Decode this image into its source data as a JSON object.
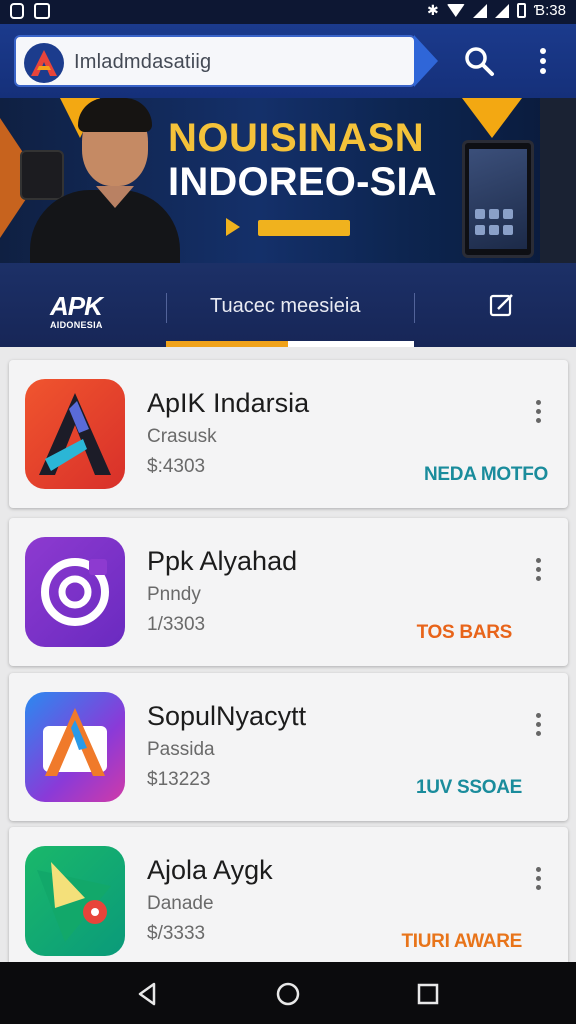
{
  "status_bar": {
    "time": "Ɓ:38",
    "left_icons": [
      "lock-icon",
      "image-icon"
    ],
    "right_icons": [
      "bluetooth-icon",
      "wifi-icon",
      "signal-icon",
      "battery-icon"
    ]
  },
  "app_bar": {
    "search_text": "Imladmdasatiig",
    "search_icon": "search-icon",
    "more_icon": "more-vertical-icon",
    "accent": "#1b3a8c"
  },
  "banner": {
    "title_line1": "NOUISINASN",
    "title_line2": "INDOREO-SIA",
    "title_color": "#f4c23a"
  },
  "tabs": {
    "logo_big": "APK",
    "logo_small": "AIDONESIA",
    "middle_label": "Tuacec meesieia",
    "edit_icon": "edit-icon",
    "indicator_color": "#f0a21a"
  },
  "apps": [
    {
      "name": "ApIK Indarsia",
      "subtitle": "Crasusk",
      "price": "$:4303",
      "tag": "NEDA MOTFO",
      "tag_color": "#1a8c9c",
      "icon": "apk-indarsia-icon"
    },
    {
      "name": "Ppk Alyahad",
      "subtitle": "Pnndy",
      "price": "1/3303",
      "tag": "TOS BARS",
      "tag_color": "#e8641a",
      "icon": "ppk-alyahad-icon"
    },
    {
      "name": "SopulNyacytt",
      "subtitle": "Passida",
      "price": "$13223",
      "tag": "1UV SSOAE",
      "tag_color": "#1a8c9c",
      "icon": "sopulnyacytt-icon"
    },
    {
      "name": "Ajola Aygk",
      "subtitle": "Danade",
      "price": "$/3333",
      "tag": "TIURI AWARE",
      "tag_color": "#e8741a",
      "icon": "ajola-aygk-icon"
    }
  ],
  "nav": {
    "icons": [
      "back-icon",
      "home-icon",
      "recents-icon"
    ]
  }
}
